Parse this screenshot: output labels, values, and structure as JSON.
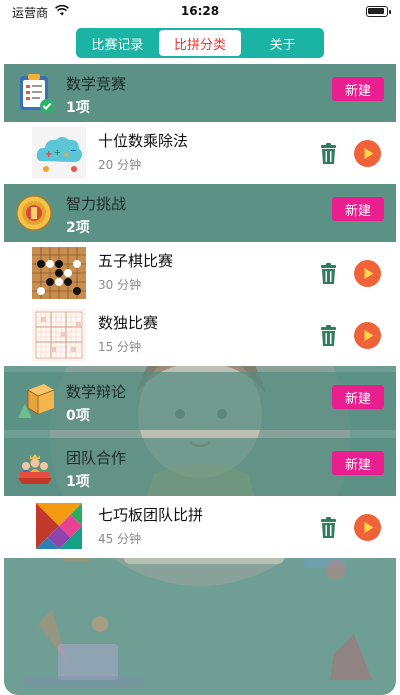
{
  "status_bar": {
    "carrier": "运营商",
    "time": "16:28"
  },
  "tabs": [
    {
      "label": "比赛记录",
      "active": false
    },
    {
      "label": "比拼分类",
      "active": true
    },
    {
      "label": "关于",
      "active": false
    }
  ],
  "new_label": "新建",
  "categories": [
    {
      "title": "数学竞赛",
      "count": "1项",
      "icon": "clipboard-checklist-icon",
      "items": [
        {
          "title": "十位数乘除法",
          "duration": "20 分钟",
          "icon": "math-cloud-icon"
        }
      ]
    },
    {
      "title": "智力挑战",
      "count": "2项",
      "icon": "gold-medal-icon",
      "items": [
        {
          "title": "五子棋比赛",
          "duration": "30 分钟",
          "icon": "gomoku-board-icon"
        },
        {
          "title": "数独比赛",
          "duration": "15 分钟",
          "icon": "sudoku-grid-icon"
        }
      ]
    },
    {
      "title": "数学辩论",
      "count": "0项",
      "icon": "geometry-shapes-icon",
      "items": []
    },
    {
      "title": "团队合作",
      "count": "1项",
      "icon": "team-podium-icon",
      "items": [
        {
          "title": "七巧板团队比拼",
          "duration": "45 分钟",
          "icon": "tangram-icon"
        }
      ]
    }
  ],
  "colors": {
    "accent_teal": "#1bb3a4",
    "new_button": "#ea1f8f",
    "play": "#f0623a",
    "trash": "#2e7d5b",
    "active_tab_text": "#e53935"
  }
}
